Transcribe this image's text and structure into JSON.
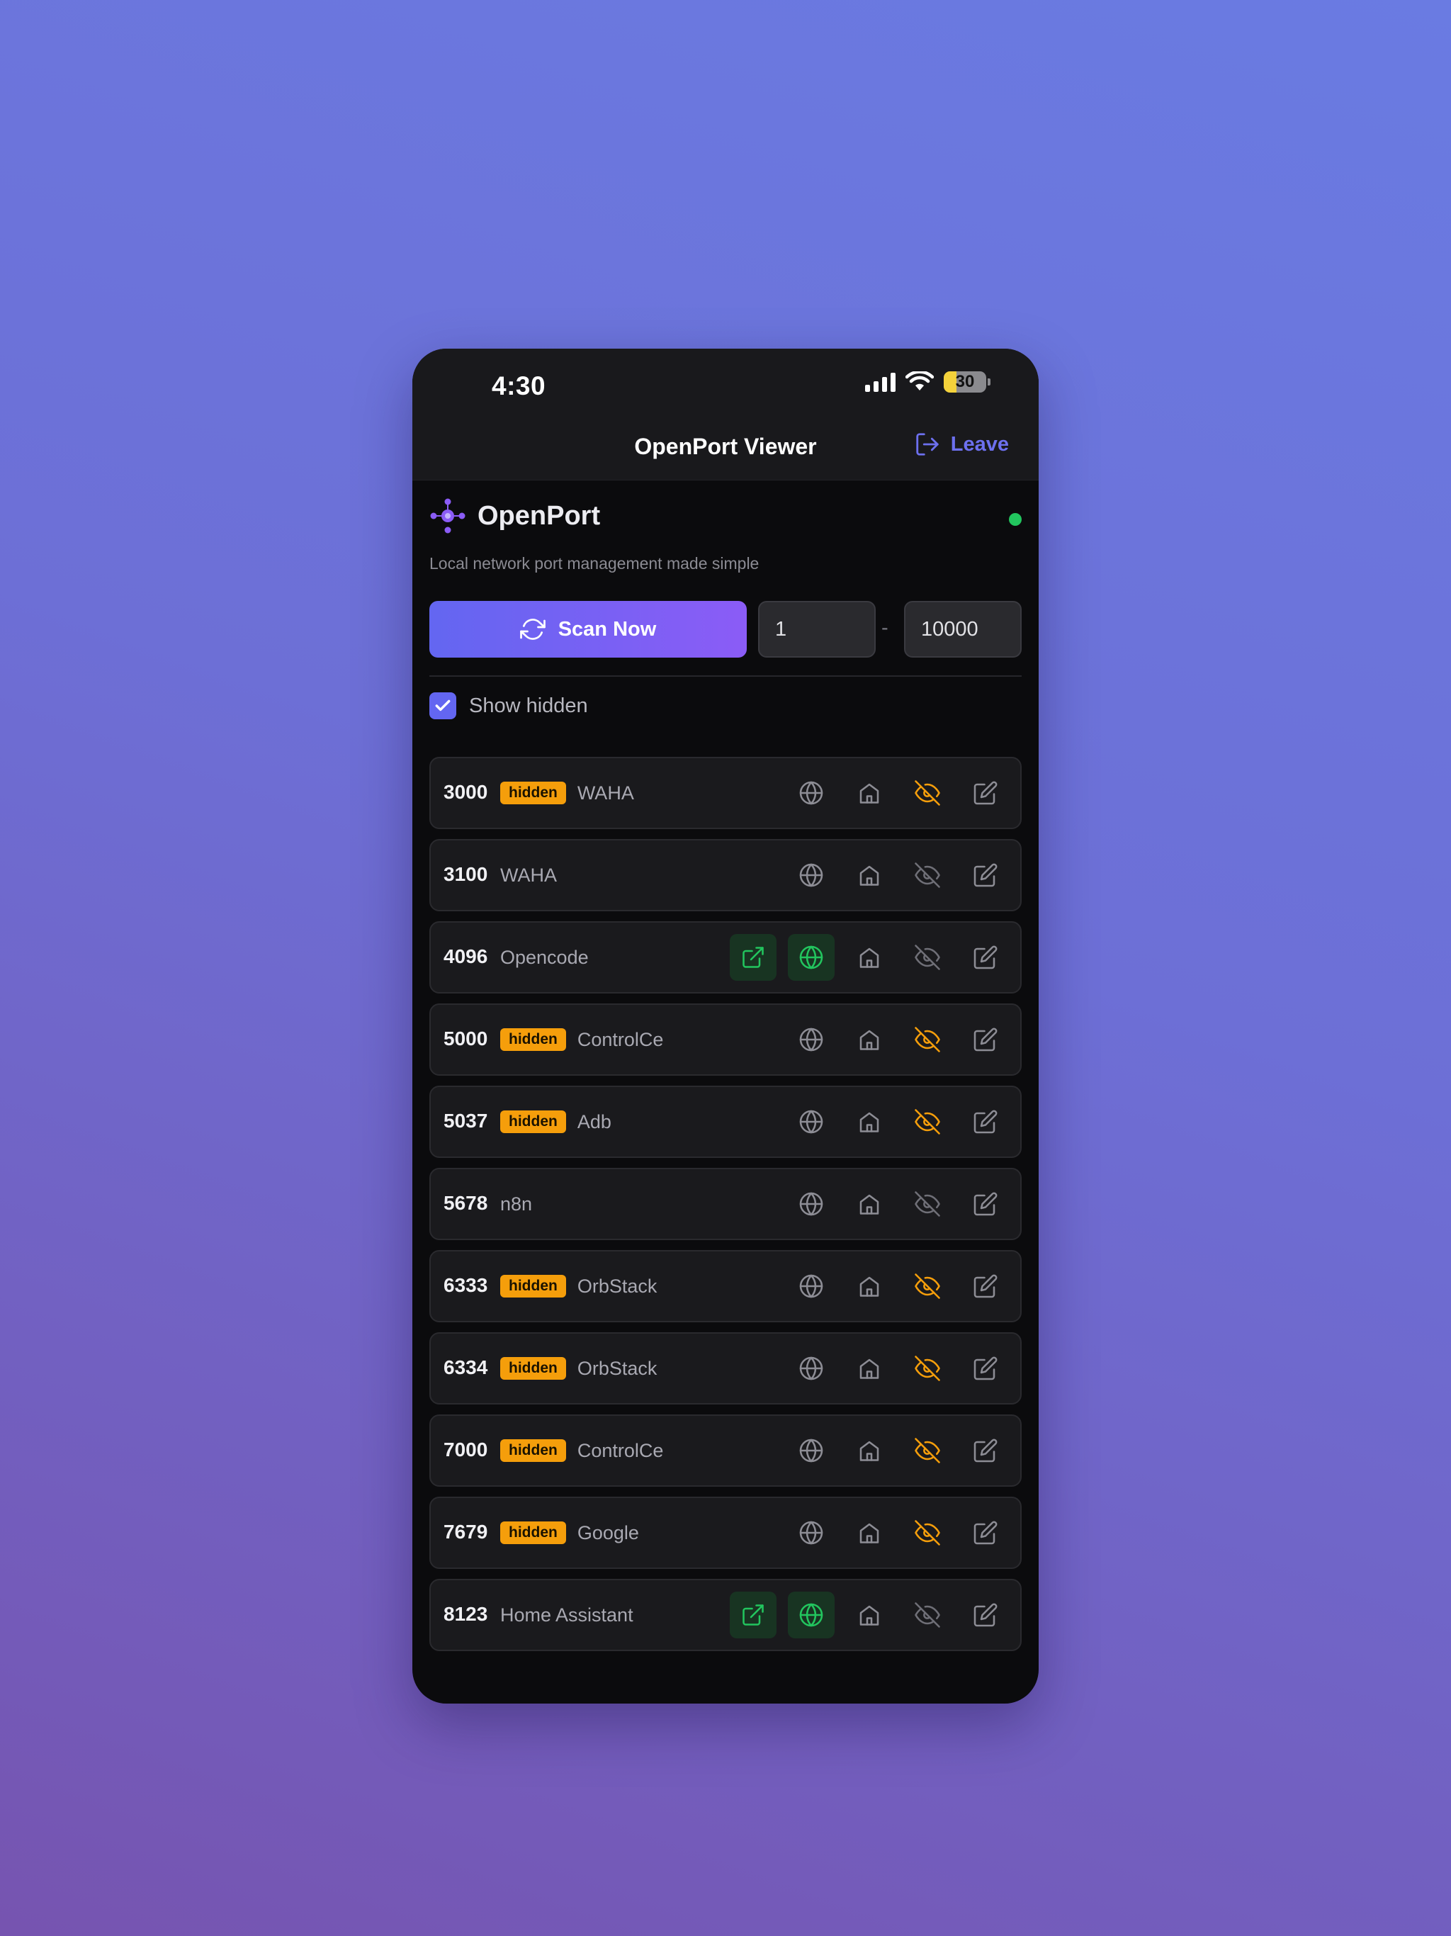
{
  "status_bar": {
    "time": "4:30",
    "battery": "30",
    "icons": [
      "signal-icon",
      "wifi-icon",
      "battery-icon"
    ]
  },
  "navbar": {
    "title": "OpenPort Viewer",
    "leave_label": "Leave"
  },
  "brand": {
    "name": "OpenPort",
    "tagline": "Local network port management made simple",
    "status": "online"
  },
  "scan": {
    "button_label": "Scan Now",
    "range_start": "1",
    "range_separator": "-",
    "range_end": "10000"
  },
  "show_hidden": {
    "label": "Show hidden",
    "checked": true
  },
  "colors": {
    "accent": "#6366f1",
    "accent_end": "#8b5cf6",
    "hidden_badge": "#f59e0b",
    "online": "#22c55e",
    "hidden_eye": "#f59e0b",
    "public_active": "#22c55e"
  },
  "ports": [
    {
      "port": "3000",
      "hidden": true,
      "badge": "hidden",
      "name": "WAHA",
      "open_link": false,
      "public": false
    },
    {
      "port": "3100",
      "hidden": false,
      "badge": "",
      "name": "WAHA",
      "open_link": false,
      "public": false
    },
    {
      "port": "4096",
      "hidden": false,
      "badge": "",
      "name": "Opencode",
      "open_link": true,
      "public": true
    },
    {
      "port": "5000",
      "hidden": true,
      "badge": "hidden",
      "name": "ControlCe",
      "open_link": false,
      "public": false
    },
    {
      "port": "5037",
      "hidden": true,
      "badge": "hidden",
      "name": "Adb",
      "open_link": false,
      "public": false
    },
    {
      "port": "5678",
      "hidden": false,
      "badge": "",
      "name": "n8n",
      "open_link": false,
      "public": false
    },
    {
      "port": "6333",
      "hidden": true,
      "badge": "hidden",
      "name": "OrbStack",
      "open_link": false,
      "public": false
    },
    {
      "port": "6334",
      "hidden": true,
      "badge": "hidden",
      "name": "OrbStack",
      "open_link": false,
      "public": false
    },
    {
      "port": "7000",
      "hidden": true,
      "badge": "hidden",
      "name": "ControlCe",
      "open_link": false,
      "public": false
    },
    {
      "port": "7679",
      "hidden": true,
      "badge": "hidden",
      "name": "Google",
      "open_link": false,
      "public": false
    },
    {
      "port": "8123",
      "hidden": false,
      "badge": "",
      "name": "Home Assistant",
      "open_link": true,
      "public": true
    }
  ]
}
